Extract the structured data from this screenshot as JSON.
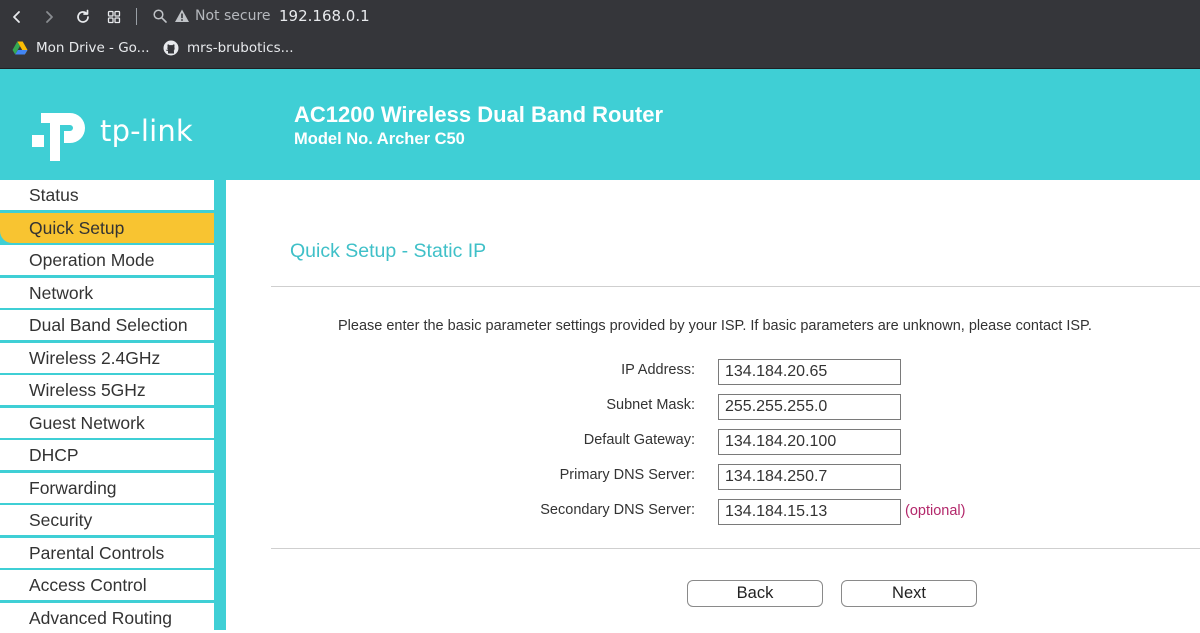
{
  "browser": {
    "security_label": "Not secure",
    "url": "192.168.0.1",
    "bookmarks": [
      {
        "label": "Mon Drive - Go...",
        "icon": "google-drive-icon"
      },
      {
        "label": "mrs-brubotics...",
        "icon": "github-icon"
      }
    ],
    "icons": [
      "back-icon",
      "forward-icon",
      "reload-icon",
      "apps-icon",
      "search-icon",
      "warning-icon"
    ]
  },
  "header": {
    "logo_text": "tp-link",
    "product_title": "AC1200 Wireless Dual Band Router",
    "model": "Model No. Archer C50"
  },
  "sidebar": {
    "items": [
      {
        "label": "Status"
      },
      {
        "label": "Quick Setup",
        "active": true
      },
      {
        "label": "Operation Mode"
      },
      {
        "label": "Network"
      },
      {
        "label": "Dual Band Selection"
      },
      {
        "label": "Wireless 2.4GHz"
      },
      {
        "label": "Wireless 5GHz"
      },
      {
        "label": "Guest Network"
      },
      {
        "label": "DHCP"
      },
      {
        "label": "Forwarding"
      },
      {
        "label": "Security"
      },
      {
        "label": "Parental Controls"
      },
      {
        "label": "Access Control"
      },
      {
        "label": "Advanced Routing"
      }
    ]
  },
  "main": {
    "heading": "Quick Setup - Static IP",
    "instructions": "Please enter the basic parameter settings provided by your ISP. If basic parameters are unknown, please contact ISP.",
    "fields": [
      {
        "label": "IP Address:",
        "value": "134.184.20.65"
      },
      {
        "label": "Subnet Mask:",
        "value": "255.255.255.0"
      },
      {
        "label": "Default Gateway:",
        "value": "134.184.20.100"
      },
      {
        "label": "Primary DNS Server:",
        "value": "134.184.250.7"
      },
      {
        "label": "Secondary DNS Server:",
        "value": "134.184.15.13",
        "note": "(optional)"
      }
    ],
    "buttons": {
      "back": "Back",
      "next": "Next"
    }
  },
  "colors": {
    "brand_teal": "#3fcfd5",
    "active_item": "#f8c431",
    "heading_text": "#3fc0c8",
    "optional_text": "#b3286b",
    "chrome_bg": "#35363a"
  }
}
